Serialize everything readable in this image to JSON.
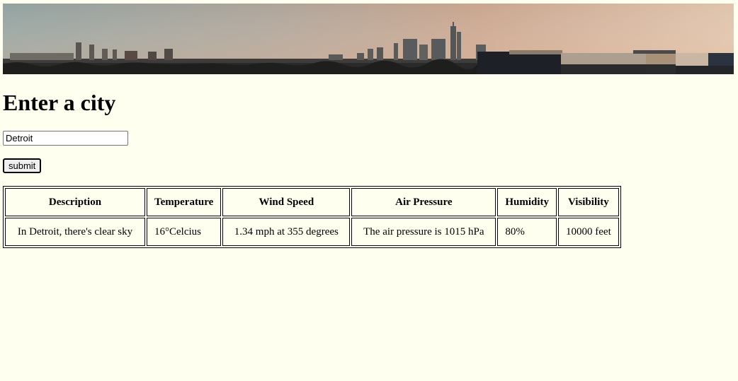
{
  "banner": {
    "image": "city-skyline-photo"
  },
  "heading": "Enter a city",
  "form": {
    "city_value": "Detroit",
    "submit_label": "submit"
  },
  "table": {
    "headers": [
      "Description",
      "Temperature",
      "Wind Speed",
      "Air Pressure",
      "Humidity",
      "Visibility"
    ],
    "row": [
      "In Detroit, there's clear sky",
      "16°Celcius",
      "1.34 mph at 355 degrees",
      "The air pressure is 1015 hPa",
      "80%",
      "10000 feet"
    ]
  },
  "colors": {
    "background": "#fffff0"
  }
}
